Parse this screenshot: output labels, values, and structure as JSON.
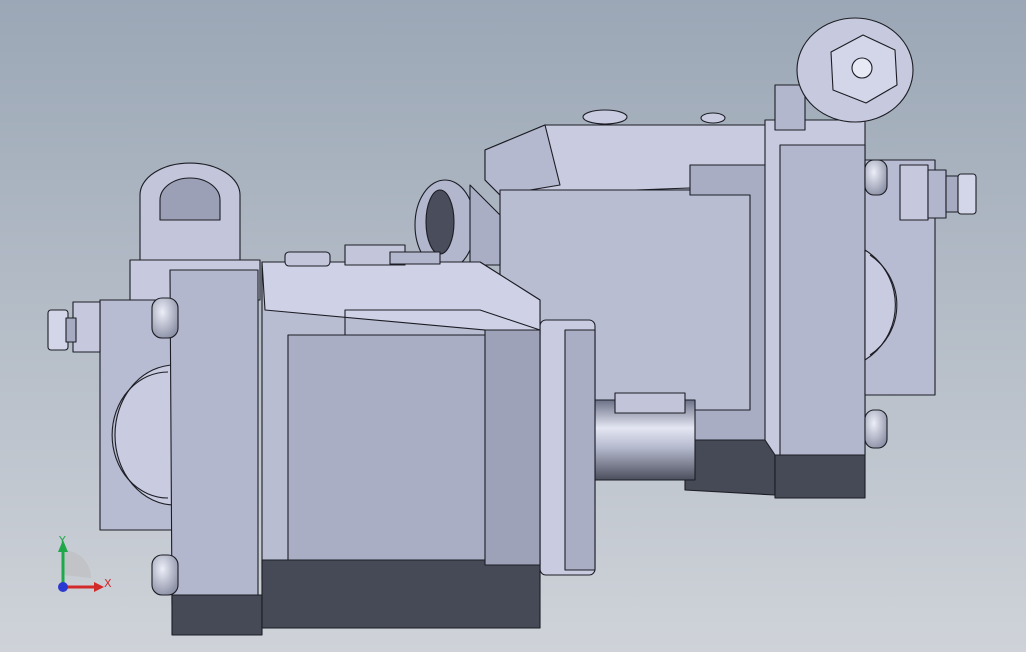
{
  "viewport": {
    "background_top": "#9ba7b6",
    "background_bottom": "#cfd3d9"
  },
  "triad": {
    "labels": {
      "x": "X",
      "y": "Y"
    },
    "x_color": "#d22a2a",
    "y_color": "#1fa84a",
    "z_color": "#2a3ad0"
  },
  "model": {
    "body_color_light": "#d3d6e9",
    "body_color_mid": "#aab0c6",
    "body_color_dark": "#7d8398",
    "shadow_color": "#464a56",
    "edge_color": "#1c1d24"
  }
}
